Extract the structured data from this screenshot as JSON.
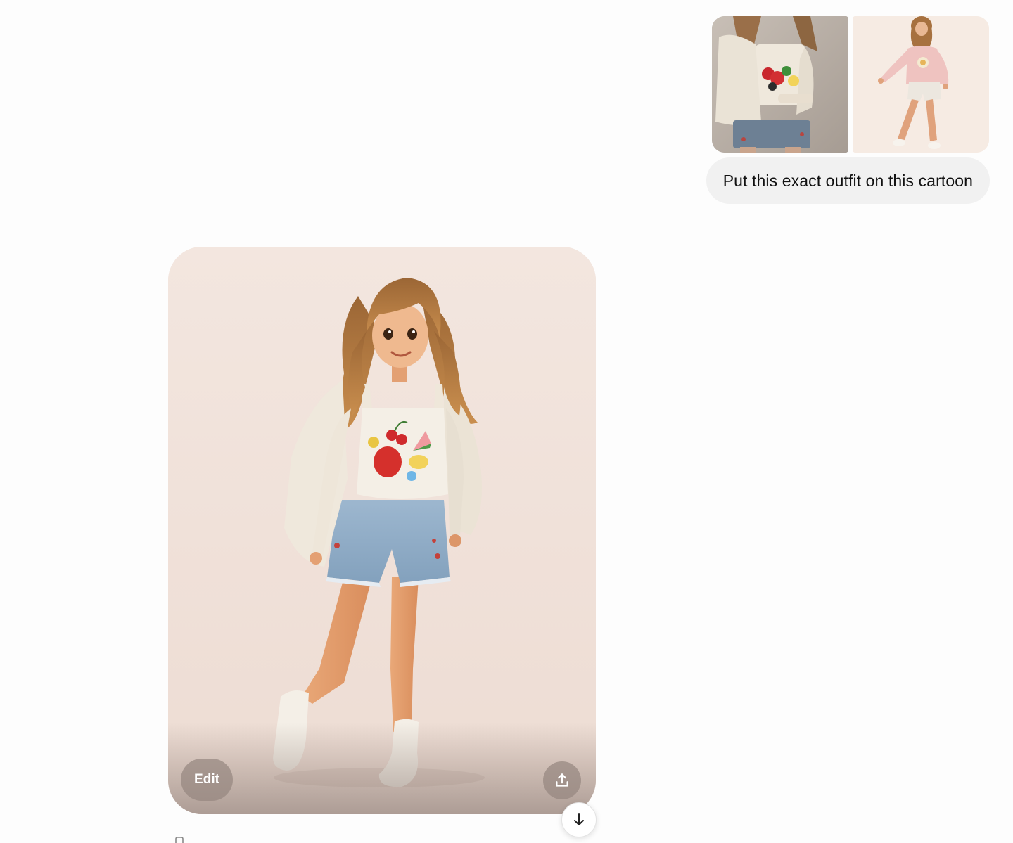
{
  "user_message": {
    "attachments": [
      {
        "name": "outfit-photo"
      },
      {
        "name": "cartoon-reference"
      }
    ],
    "text": "Put this exact outfit on this cartoon"
  },
  "assistant_message": {
    "edit_label": "Edit",
    "share_icon": "share-upload-icon"
  },
  "scroll_down_icon": "arrow-down-icon",
  "colors": {
    "page_bg": "#fdfdfd",
    "bubble_bg": "#f1f1f1",
    "card_bg": "#f1e5df"
  }
}
